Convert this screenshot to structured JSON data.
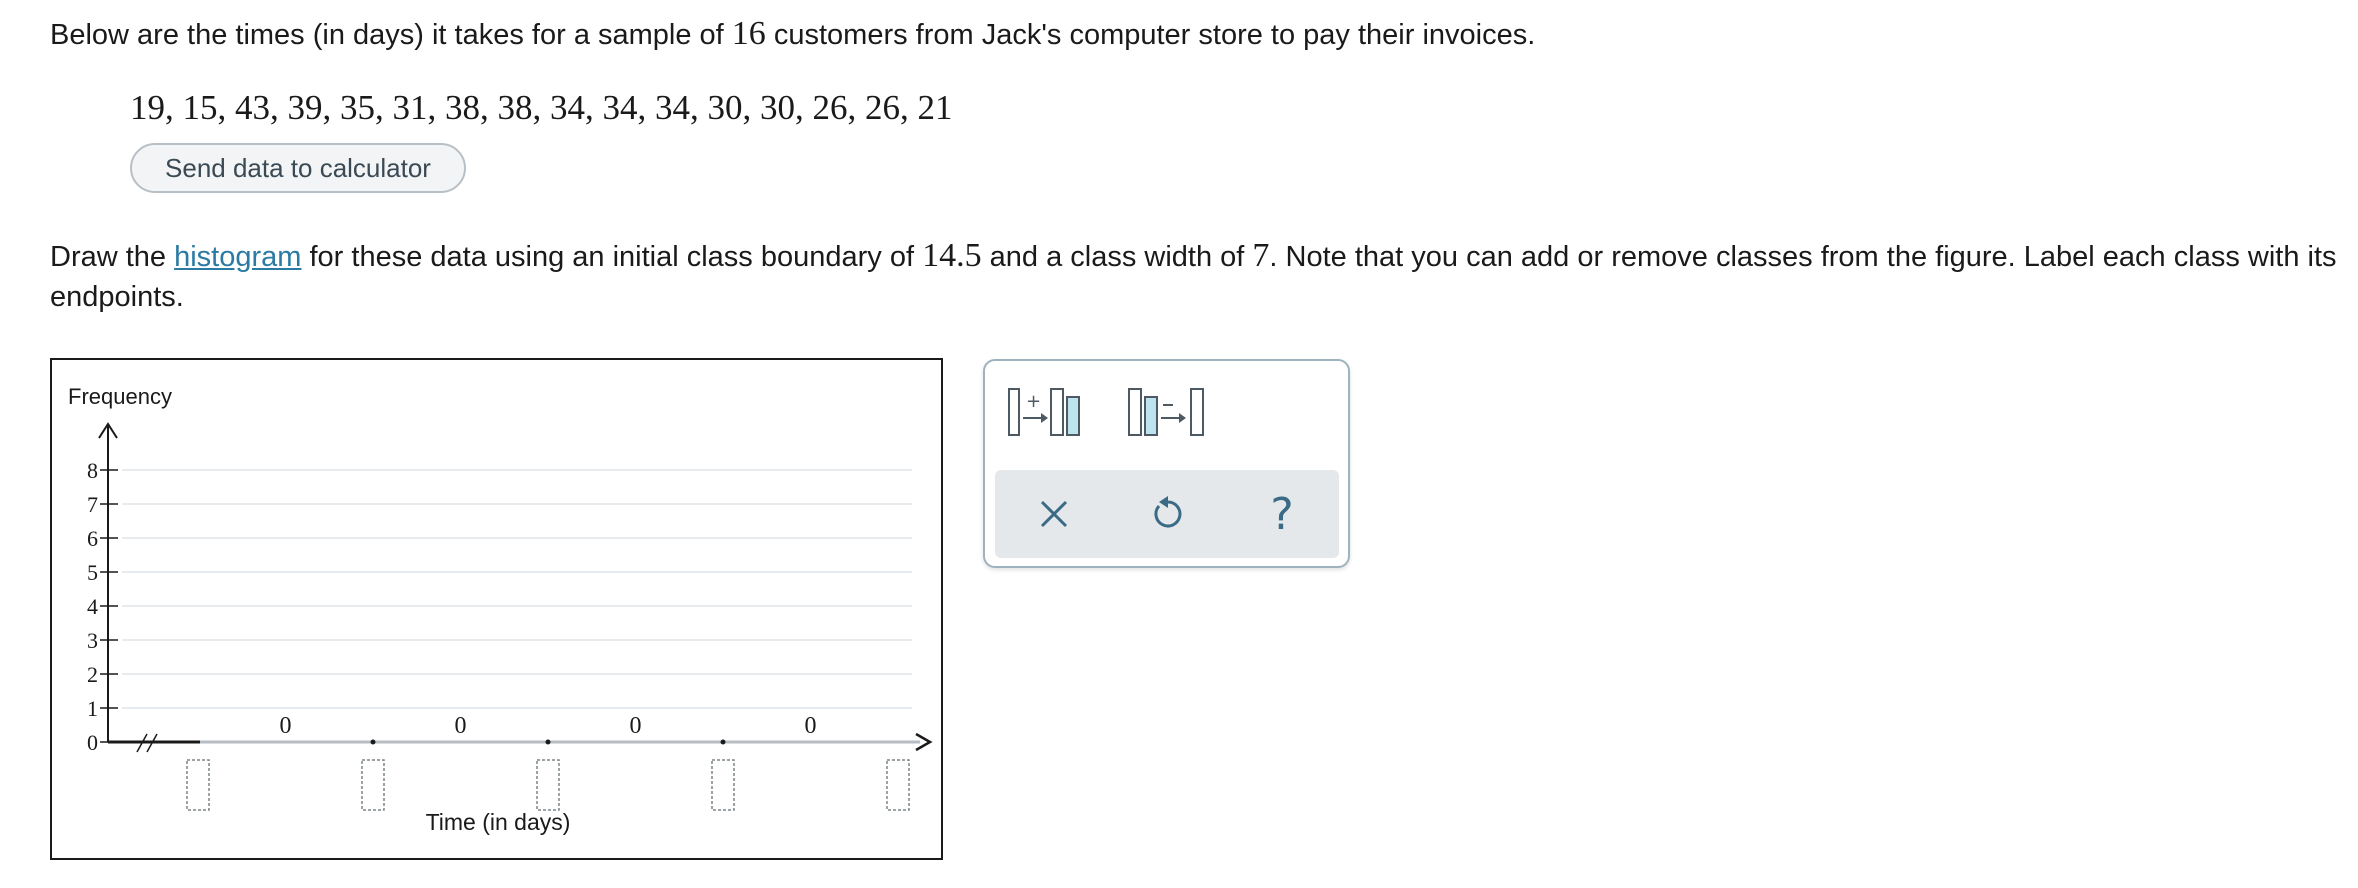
{
  "intro": {
    "before": "Below are the times (in days) it takes for a sample of ",
    "count": "16",
    "after": " customers from Jack's computer store to pay their invoices."
  },
  "data_values": "19, 15, 43, 39, 35, 31, 38, 38, 34, 34, 34, 30, 30, 26, 26, 21",
  "send_button": "Send data to calculator",
  "instructions": {
    "part1": "Draw the ",
    "link": "histogram",
    "part2": " for these data using an initial class boundary of ",
    "boundary": "14.5",
    "part3": " and a class width of ",
    "width": "7",
    "part4": ". Note that you can add or remove classes from the figure. Label each class with its endpoints."
  },
  "chart_data": {
    "type": "bar",
    "ylabel": "Frequency",
    "xlabel": "Time (in days)",
    "ylim": [
      0,
      8
    ],
    "yticks": [
      "0",
      "1",
      "2",
      "3",
      "4",
      "5",
      "6",
      "7",
      "8"
    ],
    "values": [
      0,
      0,
      0,
      0
    ],
    "bar_labels": [
      "0",
      "0",
      "0",
      "0"
    ],
    "x_label_inputs": [
      "",
      "",
      "",
      "",
      ""
    ],
    "grid": true,
    "axis_break": true
  },
  "tools": {
    "add_class": "add-class-icon",
    "remove_class": "remove-class-icon",
    "clear": "clear-icon",
    "undo": "undo-icon",
    "help": "help-icon",
    "help_glyph": "?",
    "clear_glyph": "×"
  }
}
